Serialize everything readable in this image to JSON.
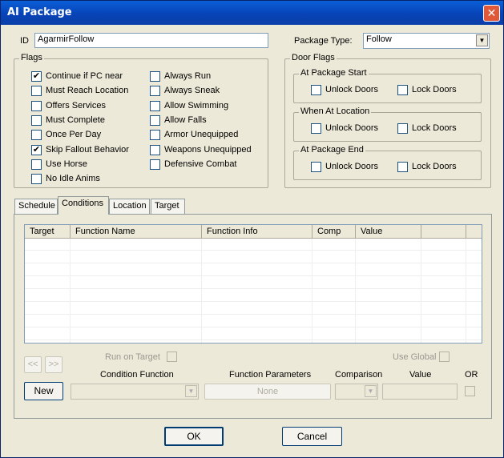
{
  "window": {
    "title": "AI Package",
    "close_glyph": "✕"
  },
  "id_field": {
    "label": "ID",
    "value": "AgarmirFollow"
  },
  "package_type": {
    "label": "Package Type:",
    "value": "Follow"
  },
  "flags": {
    "title": "Flags",
    "left": [
      {
        "label": "Continue if PC near",
        "checked": true
      },
      {
        "label": "Must Reach Location",
        "checked": false
      },
      {
        "label": "Offers Services",
        "checked": false
      },
      {
        "label": "Must Complete",
        "checked": false
      },
      {
        "label": "Once Per Day",
        "checked": false
      },
      {
        "label": "Skip Fallout Behavior",
        "checked": true
      },
      {
        "label": "Use Horse",
        "checked": false
      },
      {
        "label": "No Idle Anims",
        "checked": false
      }
    ],
    "right": [
      {
        "label": "Always Run",
        "checked": false
      },
      {
        "label": "Always Sneak",
        "checked": false
      },
      {
        "label": "Allow Swimming",
        "checked": false
      },
      {
        "label": "Allow Falls",
        "checked": false
      },
      {
        "label": "Armor Unequipped",
        "checked": false
      },
      {
        "label": "Weapons Unequipped",
        "checked": false
      },
      {
        "label": "Defensive Combat",
        "checked": false
      }
    ]
  },
  "door_flags": {
    "title": "Door Flags",
    "groups": [
      {
        "title": "At Package Start",
        "unlock": "Unlock Doors",
        "lock": "Lock Doors"
      },
      {
        "title": "When At Location",
        "unlock": "Unlock Doors",
        "lock": "Lock Doors"
      },
      {
        "title": "At Package End",
        "unlock": "Unlock Doors",
        "lock": "Lock Doors"
      }
    ]
  },
  "tabs": [
    "Schedule",
    "Conditions",
    "Location",
    "Target"
  ],
  "conditions": {
    "columns": [
      "Target",
      "Function Name",
      "Function Info",
      "Comp",
      "Value",
      ""
    ],
    "run_on_target": "Run on Target",
    "use_global": "Use Global",
    "prev_glyph": "<<",
    "next_glyph": ">>",
    "new_button": "New",
    "condition_function_label": "Condition Function",
    "function_parameters_label": "Function Parameters",
    "function_parameters_value": "None",
    "comparison_label": "Comparison",
    "value_label": "Value",
    "or_label": "OR"
  },
  "buttons": {
    "ok": "OK",
    "cancel": "Cancel"
  }
}
